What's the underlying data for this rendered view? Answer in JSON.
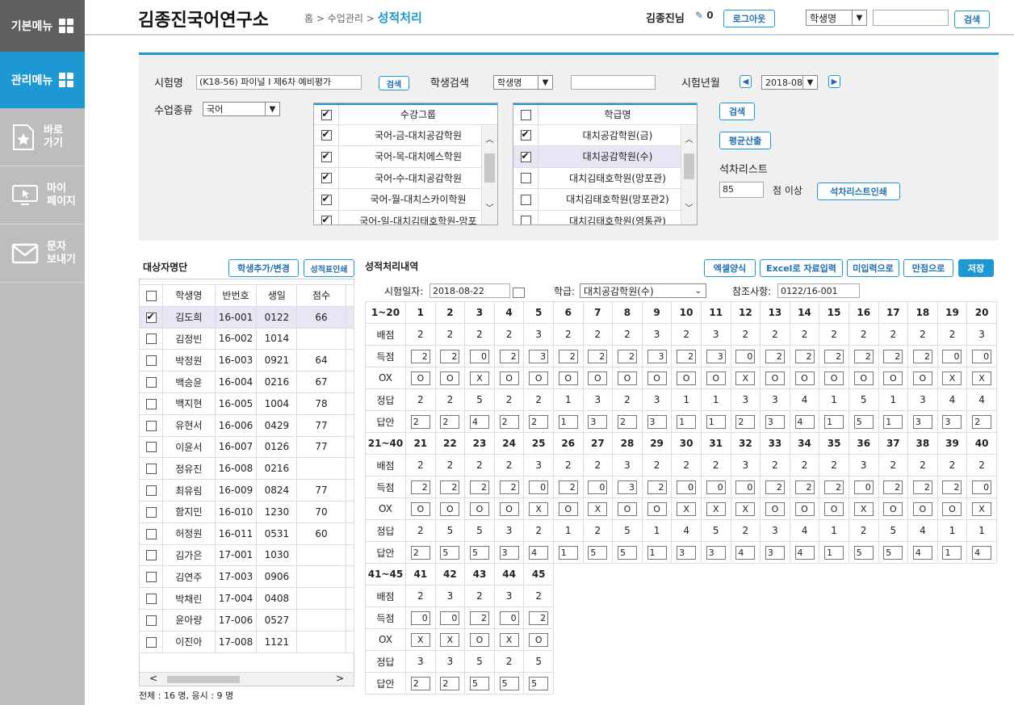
{
  "sidebar": {
    "top": "기본메뉴",
    "admin": "관리메뉴",
    "items": [
      {
        "l1": "바로",
        "l2": "가기"
      },
      {
        "l1": "마이",
        "l2": "페이지"
      },
      {
        "l1": "문자",
        "l2": "보내기"
      }
    ]
  },
  "header": {
    "logo": "김종진국어연구소",
    "crumb1": "홈",
    "crumb2": "수업관리",
    "current": "성적처리",
    "user": "김종진님",
    "count": "0",
    "logout": "로그아웃",
    "search_select": "학생명",
    "search_btn": "검색"
  },
  "filter": {
    "exam_label": "시험명",
    "exam_value": "(K18-56) 파이널 I  제6차 예비평가",
    "exam_btn": "검색",
    "student_label": "학생검색",
    "student_select": "학생명",
    "month_label": "시험년월",
    "month_value": "2018-08",
    "class_label": "수업종류",
    "class_value": "국어",
    "group_header": "수강그룹",
    "groups": [
      {
        "n": "국어-금-대치공감학원",
        "c": true
      },
      {
        "n": "국어-목-대치에스학원",
        "c": true
      },
      {
        "n": "국어-수-대치공감학원",
        "c": true
      },
      {
        "n": "국어-월-대치스카이학원",
        "c": true
      },
      {
        "n": "국어-일-대치김태호학원-망포",
        "c": true
      }
    ],
    "academy_header": "학급명",
    "academies": [
      {
        "n": "대치공감학원(금)",
        "c": true
      },
      {
        "n": "대치공감학원(수)",
        "c": true
      },
      {
        "n": "대치김태호학원(망포관)",
        "c": false
      },
      {
        "n": "대치김태호학원(망포관2)",
        "c": false
      },
      {
        "n": "대치김태호학원(영통관)",
        "c": false
      }
    ],
    "search2": "검색",
    "avg": "평균산출",
    "rank_label": "석차리스트",
    "rank_value": "85",
    "rank_unit": "점 이상",
    "rank_print": "석차리스트인쇄"
  },
  "students": {
    "title": "대상자명단",
    "add_btn": "학생추가/변경",
    "print_btn": "성적표인쇄",
    "cols": [
      "학생명",
      "반번호",
      "생일",
      "점수"
    ],
    "rows": [
      [
        "김도희",
        "16-001",
        "0122",
        "66",
        true
      ],
      [
        "김정빈",
        "16-002",
        "1014",
        "",
        false
      ],
      [
        "박정원",
        "16-003",
        "0921",
        "64",
        false
      ],
      [
        "백승윤",
        "16-004",
        "0216",
        "67",
        false
      ],
      [
        "백지현",
        "16-005",
        "1004",
        "78",
        false
      ],
      [
        "유현서",
        "16-006",
        "0429",
        "77",
        false
      ],
      [
        "이윤서",
        "16-007",
        "0126",
        "77",
        false
      ],
      [
        "정유진",
        "16-008",
        "0216",
        "",
        false
      ],
      [
        "최유림",
        "16-009",
        "0824",
        "77",
        false
      ],
      [
        "함지민",
        "16-010",
        "1230",
        "70",
        false
      ],
      [
        "허정원",
        "16-011",
        "0531",
        "60",
        false
      ],
      [
        "김가은",
        "17-001",
        "1030",
        "",
        false
      ],
      [
        "김연주",
        "17-003",
        "0906",
        "",
        false
      ],
      [
        "박채린",
        "17-004",
        "0408",
        "",
        false
      ],
      [
        "윤아량",
        "17-006",
        "0527",
        "",
        false
      ],
      [
        "이진아",
        "17-008",
        "1121",
        "",
        false
      ]
    ],
    "total": "전체 : 16 명, 응시 : 9 명"
  },
  "grades": {
    "title": "성적처리내역",
    "excel_form": "엑셀양식",
    "excel_input": "Excel로 자료입력",
    "unentered": "미입력으로",
    "full": "만점으로",
    "save": "저장",
    "date_label": "시험일자:",
    "date": "2018-08-22",
    "class_label": "학급:",
    "class_value": "대치공감학원(수)",
    "ref_label": "참조사항:",
    "ref_value": "0122/16-001",
    "row_labels": [
      "배점",
      "득점",
      "OX",
      "정답",
      "답안"
    ],
    "blocks": [
      {
        "range": "1~20",
        "nums": [
          "1",
          "2",
          "3",
          "4",
          "5",
          "6",
          "7",
          "8",
          "9",
          "10",
          "11",
          "12",
          "13",
          "14",
          "15",
          "16",
          "17",
          "18",
          "19",
          "20"
        ],
        "points": [
          "2",
          "2",
          "2",
          "2",
          "3",
          "2",
          "2",
          "2",
          "3",
          "2",
          "3",
          "2",
          "2",
          "2",
          "2",
          "2",
          "2",
          "2",
          "2",
          "3"
        ],
        "scores": [
          "2",
          "2",
          "0",
          "2",
          "3",
          "2",
          "2",
          "2",
          "3",
          "2",
          "3",
          "0",
          "2",
          "2",
          "2",
          "2",
          "2",
          "2",
          "0",
          "0"
        ],
        "ox": [
          "O",
          "O",
          "X",
          "O",
          "O",
          "O",
          "O",
          "O",
          "O",
          "O",
          "O",
          "X",
          "O",
          "O",
          "O",
          "O",
          "O",
          "O",
          "X",
          "X"
        ],
        "answers": [
          "2",
          "2",
          "5",
          "2",
          "2",
          "1",
          "3",
          "2",
          "3",
          "1",
          "1",
          "3",
          "3",
          "4",
          "1",
          "5",
          "1",
          "3",
          "4",
          "4"
        ],
        "responses": [
          "2",
          "2",
          "4",
          "2",
          "2",
          "1",
          "3",
          "2",
          "3",
          "1",
          "1",
          "2",
          "3",
          "4",
          "1",
          "5",
          "1",
          "3",
          "3",
          "2"
        ]
      },
      {
        "range": "21~40",
        "nums": [
          "21",
          "22",
          "23",
          "24",
          "25",
          "26",
          "27",
          "28",
          "29",
          "30",
          "31",
          "32",
          "33",
          "34",
          "35",
          "36",
          "37",
          "38",
          "39",
          "40"
        ],
        "points": [
          "2",
          "2",
          "2",
          "2",
          "3",
          "2",
          "2",
          "3",
          "2",
          "2",
          "2",
          "3",
          "2",
          "2",
          "2",
          "3",
          "2",
          "2",
          "2",
          "2"
        ],
        "scores": [
          "2",
          "2",
          "2",
          "2",
          "0",
          "2",
          "0",
          "3",
          "2",
          "0",
          "0",
          "0",
          "2",
          "2",
          "2",
          "0",
          "2",
          "2",
          "2",
          "0"
        ],
        "ox": [
          "O",
          "O",
          "O",
          "O",
          "X",
          "O",
          "X",
          "O",
          "O",
          "X",
          "X",
          "X",
          "O",
          "O",
          "O",
          "X",
          "O",
          "O",
          "O",
          "X"
        ],
        "answers": [
          "2",
          "5",
          "5",
          "3",
          "2",
          "1",
          "2",
          "5",
          "1",
          "4",
          "5",
          "2",
          "3",
          "4",
          "1",
          "2",
          "5",
          "4",
          "1",
          "1"
        ],
        "responses": [
          "2",
          "5",
          "5",
          "3",
          "4",
          "1",
          "5",
          "5",
          "1",
          "3",
          "3",
          "4",
          "3",
          "4",
          "1",
          "5",
          "5",
          "4",
          "1",
          "4"
        ]
      },
      {
        "range": "41~45",
        "nums": [
          "41",
          "42",
          "43",
          "44",
          "45"
        ],
        "points": [
          "2",
          "3",
          "2",
          "3",
          "2"
        ],
        "scores": [
          "0",
          "0",
          "2",
          "0",
          "2"
        ],
        "ox": [
          "X",
          "X",
          "O",
          "X",
          "O"
        ],
        "answers": [
          "3",
          "3",
          "5",
          "2",
          "5"
        ],
        "responses": [
          "2",
          "2",
          "5",
          "5",
          "5"
        ]
      }
    ]
  }
}
